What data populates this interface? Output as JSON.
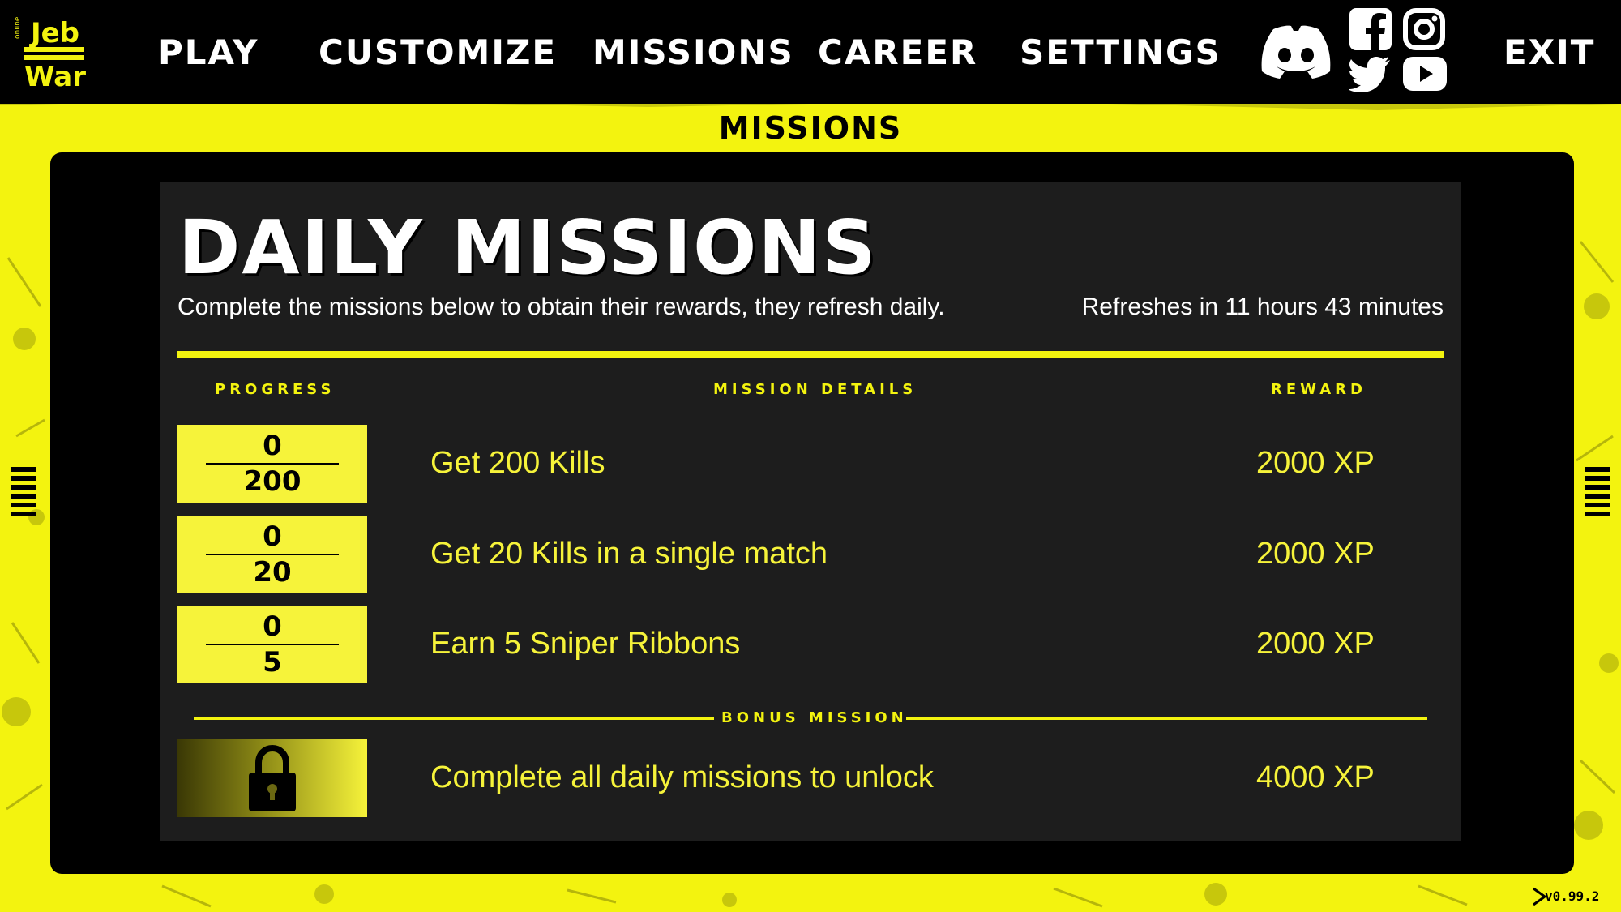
{
  "app": {
    "logo_text": [
      "Jeb",
      "War"
    ],
    "logo_small": "online"
  },
  "nav": {
    "play": "PLAY",
    "customize": "CUSTOMIZE",
    "missions": "MISSIONS",
    "career": "CAREER",
    "settings": "SETTINGS",
    "exit": "EXIT"
  },
  "social": [
    "discord-icon",
    "facebook-icon",
    "instagram-icon",
    "twitter-icon",
    "youtube-icon"
  ],
  "section_title": "MISSIONS",
  "panel": {
    "title": "DAILY MISSIONS",
    "subtitle": "Complete the missions below to obtain their rewards, they refresh daily.",
    "refresh": "Refreshes in 11 hours 43 minutes"
  },
  "columns": {
    "progress": "PROGRESS",
    "details": "MISSION DETAILS",
    "reward": "REWARD"
  },
  "missions": [
    {
      "current": "0",
      "target": "200",
      "text": "Get 200 Kills",
      "reward": "2000 XP"
    },
    {
      "current": "0",
      "target": "20",
      "text": "Get 20 Kills in a single match",
      "reward": "2000 XP"
    },
    {
      "current": "0",
      "target": "5",
      "text": "Earn 5 Sniper Ribbons",
      "reward": "2000 XP"
    }
  ],
  "bonus": {
    "label": "BONUS MISSION",
    "text": "Complete all daily missions to unlock",
    "reward": "4000 XP",
    "icon": "lock-icon"
  },
  "version": "v0.99.2",
  "colors": {
    "accent": "#f3f30f",
    "panel": "#1d1d1d",
    "background": "#000000"
  }
}
